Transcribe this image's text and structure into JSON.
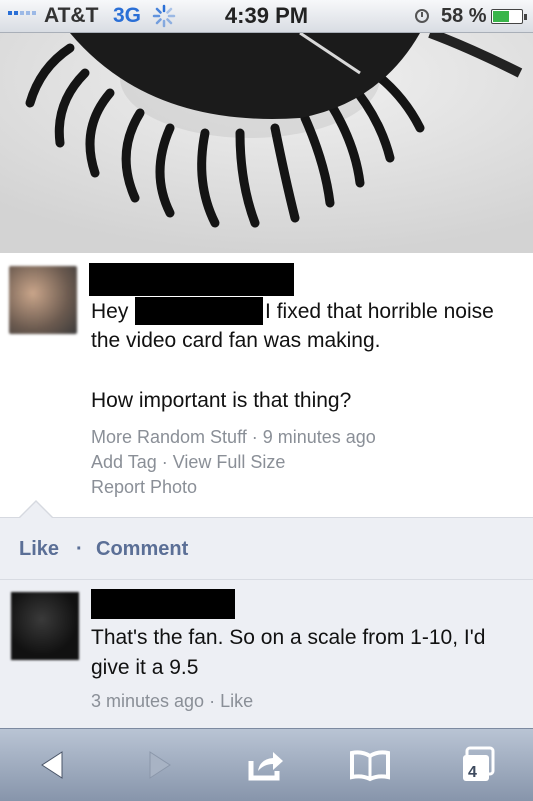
{
  "status_bar": {
    "carrier": "AT&T",
    "network": "3G",
    "time": "4:39 PM",
    "battery": "58 %",
    "battery_level": 0.58,
    "icons": [
      "signal-bars-icon",
      "activity-spinner-icon",
      "alarm-clock-icon",
      "battery-icon"
    ]
  },
  "post": {
    "text_before_redaction": "Hey",
    "text_after_redaction": ", I fixed that horrible noise the video card fan was making.",
    "question": "How important is that thing?",
    "meta_line1": [
      "More Random Stuff",
      "9 minutes ago"
    ],
    "meta_line2": [
      "Add Tag",
      "View Full Size"
    ],
    "meta_line3": "Report Photo",
    "separator": "·"
  },
  "actions": {
    "like": "Like",
    "separator": "·",
    "comment": "Comment"
  },
  "comment": {
    "text": "That's the fan. So on a scale from 1-10, I'd give it a 9.5",
    "time": "3 minutes ago",
    "separator": "·",
    "like": "Like"
  },
  "toolbar": {
    "tabs_count": "4",
    "icons": [
      "back-arrow-icon",
      "forward-arrow-icon",
      "share-icon",
      "bookmarks-icon",
      "tabs-icon"
    ]
  },
  "colors": {
    "link": "#5b6f96",
    "meta": "#8a8f97",
    "toolbar": "#9aa7bb",
    "network": "#2a6fd6"
  }
}
